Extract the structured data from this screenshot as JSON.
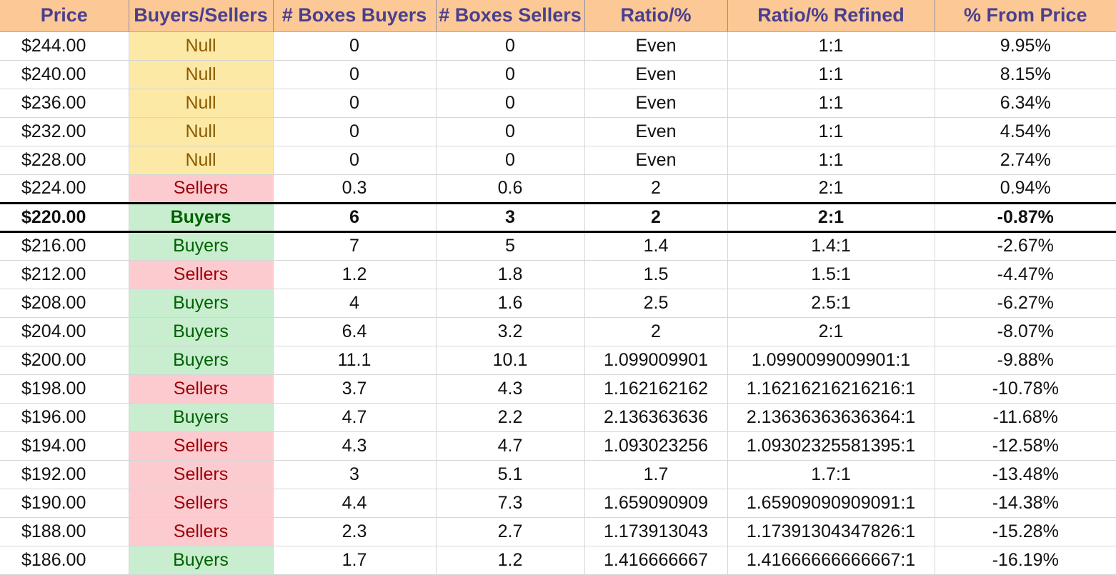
{
  "colors": {
    "header_bg": "#fcc996",
    "header_text": "#4a3f8f",
    "null_bg": "#fde9a6",
    "null_text": "#8a5a00",
    "sellers_bg": "#fccbd0",
    "sellers_text": "#9c0006",
    "buyers_bg": "#c8eecf",
    "buyers_text": "#006100"
  },
  "headers": [
    "Price",
    "Buyers/Sellers",
    "# Boxes Buyers",
    "# Boxes Sellers",
    "Ratio/%",
    "Ratio/% Refined",
    "% From Price"
  ],
  "rows": [
    {
      "price": "$244.00",
      "side": "Null",
      "buyers": "0",
      "sellers": "0",
      "ratio": "Even",
      "refined": "1:1",
      "from_price": "9.95%"
    },
    {
      "price": "$240.00",
      "side": "Null",
      "buyers": "0",
      "sellers": "0",
      "ratio": "Even",
      "refined": "1:1",
      "from_price": "8.15%"
    },
    {
      "price": "$236.00",
      "side": "Null",
      "buyers": "0",
      "sellers": "0",
      "ratio": "Even",
      "refined": "1:1",
      "from_price": "6.34%"
    },
    {
      "price": "$232.00",
      "side": "Null",
      "buyers": "0",
      "sellers": "0",
      "ratio": "Even",
      "refined": "1:1",
      "from_price": "4.54%"
    },
    {
      "price": "$228.00",
      "side": "Null",
      "buyers": "0",
      "sellers": "0",
      "ratio": "Even",
      "refined": "1:1",
      "from_price": "2.74%"
    },
    {
      "price": "$224.00",
      "side": "Sellers",
      "buyers": "0.3",
      "sellers": "0.6",
      "ratio": "2",
      "refined": "2:1",
      "from_price": "0.94%"
    },
    {
      "price": "$220.00",
      "side": "Buyers",
      "buyers": "6",
      "sellers": "3",
      "ratio": "2",
      "refined": "2:1",
      "from_price": "-0.87%",
      "current": true
    },
    {
      "price": "$216.00",
      "side": "Buyers",
      "buyers": "7",
      "sellers": "5",
      "ratio": "1.4",
      "refined": "1.4:1",
      "from_price": "-2.67%"
    },
    {
      "price": "$212.00",
      "side": "Sellers",
      "buyers": "1.2",
      "sellers": "1.8",
      "ratio": "1.5",
      "refined": "1.5:1",
      "from_price": "-4.47%"
    },
    {
      "price": "$208.00",
      "side": "Buyers",
      "buyers": "4",
      "sellers": "1.6",
      "ratio": "2.5",
      "refined": "2.5:1",
      "from_price": "-6.27%"
    },
    {
      "price": "$204.00",
      "side": "Buyers",
      "buyers": "6.4",
      "sellers": "3.2",
      "ratio": "2",
      "refined": "2:1",
      "from_price": "-8.07%"
    },
    {
      "price": "$200.00",
      "side": "Buyers",
      "buyers": "11.1",
      "sellers": "10.1",
      "ratio": "1.099009901",
      "refined": "1.0990099009901:1",
      "from_price": "-9.88%"
    },
    {
      "price": "$198.00",
      "side": "Sellers",
      "buyers": "3.7",
      "sellers": "4.3",
      "ratio": "1.162162162",
      "refined": "1.16216216216216:1",
      "from_price": "-10.78%"
    },
    {
      "price": "$196.00",
      "side": "Buyers",
      "buyers": "4.7",
      "sellers": "2.2",
      "ratio": "2.136363636",
      "refined": "2.13636363636364:1",
      "from_price": "-11.68%"
    },
    {
      "price": "$194.00",
      "side": "Sellers",
      "buyers": "4.3",
      "sellers": "4.7",
      "ratio": "1.093023256",
      "refined": "1.09302325581395:1",
      "from_price": "-12.58%"
    },
    {
      "price": "$192.00",
      "side": "Sellers",
      "buyers": "3",
      "sellers": "5.1",
      "ratio": "1.7",
      "refined": "1.7:1",
      "from_price": "-13.48%"
    },
    {
      "price": "$190.00",
      "side": "Sellers",
      "buyers": "4.4",
      "sellers": "7.3",
      "ratio": "1.659090909",
      "refined": "1.65909090909091:1",
      "from_price": "-14.38%"
    },
    {
      "price": "$188.00",
      "side": "Sellers",
      "buyers": "2.3",
      "sellers": "2.7",
      "ratio": "1.173913043",
      "refined": "1.17391304347826:1",
      "from_price": "-15.28%"
    },
    {
      "price": "$186.00",
      "side": "Buyers",
      "buyers": "1.7",
      "sellers": "1.2",
      "ratio": "1.416666667",
      "refined": "1.41666666666667:1",
      "from_price": "-16.19%"
    }
  ]
}
